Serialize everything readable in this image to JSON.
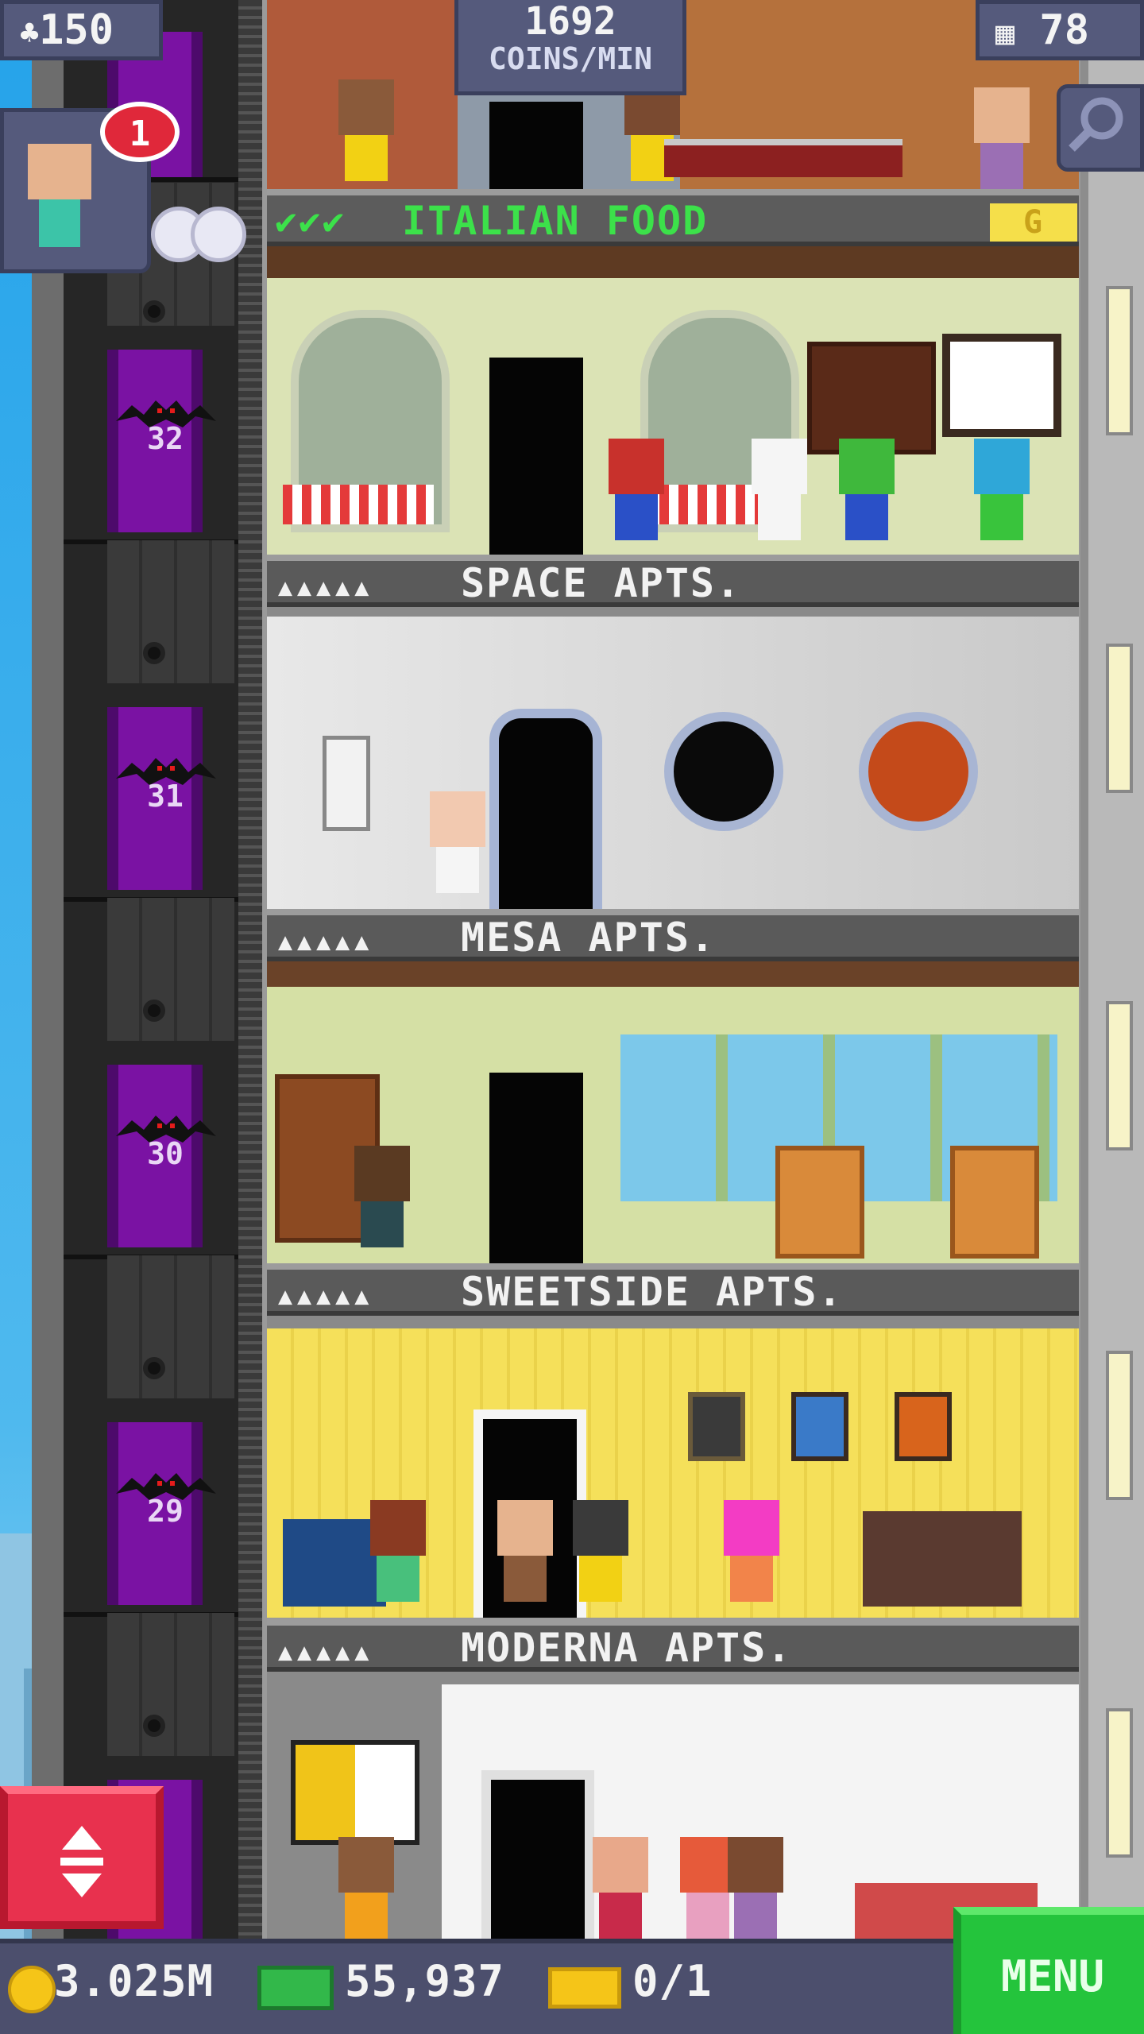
{
  "hud": {
    "population": "150",
    "coins_per_min_value": "1692",
    "coins_per_min_label": "COINS/MIN",
    "floors": "78",
    "notification_count": "1"
  },
  "italian_food": {
    "title": "ITALIAN FOOD",
    "stock_checks": 3,
    "badge": "G"
  },
  "floors_shaft": [
    "32",
    "31",
    "30",
    "29"
  ],
  "apartment_signs": [
    {
      "name": "SPACE APTS.",
      "occupants": 5
    },
    {
      "name": "MESA APTS.",
      "occupants": 5
    },
    {
      "name": "SWEETSIDE APTS.",
      "occupants": 5
    },
    {
      "name": "MODERNA APTS.",
      "occupants": 5
    }
  ],
  "bottom": {
    "coins": "3.025M",
    "bux": "55,937",
    "tickets": "0/1",
    "menu_label": "MENU"
  },
  "colors": {
    "elevator_car": "#7a12a3",
    "sign_bg": "#5a5a5a",
    "menu_green": "#24c43c",
    "elevator_button": "#e8314e",
    "hud_badge": "#555a7c"
  }
}
